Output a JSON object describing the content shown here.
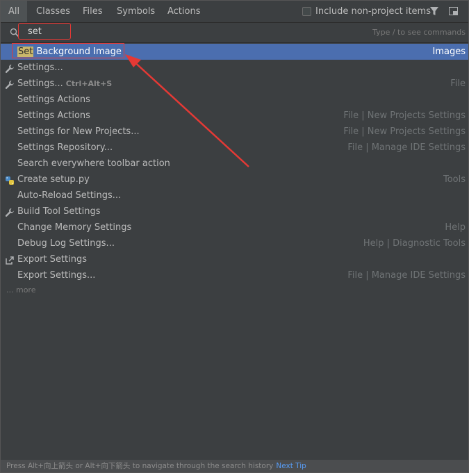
{
  "tabs": [
    "All",
    "Classes",
    "Files",
    "Symbols",
    "Actions"
  ],
  "include_label": "Include non-project items",
  "search": {
    "value": "set",
    "hint": "Type / to see commands"
  },
  "results": [
    {
      "pre": "",
      "hl": "Set",
      "post": " Background Image",
      "shortcut": "",
      "loc": "Images",
      "icon": "",
      "selected": true
    },
    {
      "pre": "Settings...",
      "hl": "",
      "post": "",
      "shortcut": "",
      "loc": "",
      "icon": "wrench-icon"
    },
    {
      "pre": "Settings...",
      "hl": "",
      "post": "",
      "shortcut": "Ctrl+Alt+S",
      "loc": "File",
      "icon": "wrench-icon"
    },
    {
      "pre": "Settings Actions",
      "hl": "",
      "post": "",
      "shortcut": "",
      "loc": "",
      "icon": ""
    },
    {
      "pre": "Settings Actions",
      "hl": "",
      "post": "",
      "shortcut": "",
      "loc": "File | New Projects Settings",
      "icon": ""
    },
    {
      "pre": "Settings for New Projects...",
      "hl": "",
      "post": "",
      "shortcut": "",
      "loc": "File | New Projects Settings",
      "icon": ""
    },
    {
      "pre": "Settings Repository...",
      "hl": "",
      "post": "",
      "shortcut": "",
      "loc": "File | Manage IDE Settings",
      "icon": ""
    },
    {
      "pre": "Search everywhere toolbar action",
      "hl": "",
      "post": "",
      "shortcut": "",
      "loc": "",
      "icon": ""
    },
    {
      "pre": "Create setup.py",
      "hl": "",
      "post": "",
      "shortcut": "",
      "loc": "Tools",
      "icon": "python-icon"
    },
    {
      "pre": "Auto-Reload Settings...",
      "hl": "",
      "post": "",
      "shortcut": "",
      "loc": "",
      "icon": ""
    },
    {
      "pre": "Build Tool Settings",
      "hl": "",
      "post": "",
      "shortcut": "",
      "loc": "",
      "icon": "wrench-icon"
    },
    {
      "pre": "Change Memory Settings",
      "hl": "",
      "post": "",
      "shortcut": "",
      "loc": "Help",
      "icon": ""
    },
    {
      "pre": "Debug Log Settings...",
      "hl": "",
      "post": "",
      "shortcut": "",
      "loc": "Help | Diagnostic Tools",
      "icon": ""
    },
    {
      "pre": "Export Settings",
      "hl": "",
      "post": "",
      "shortcut": "",
      "loc": "",
      "icon": "export-icon"
    },
    {
      "pre": "Export Settings...",
      "hl": "",
      "post": "",
      "shortcut": "",
      "loc": "File | Manage IDE Settings",
      "icon": ""
    }
  ],
  "more_label": "... more",
  "status": {
    "text": "Press Alt+向上箭头 or Alt+向下箭头 to navigate through the search history",
    "link": "Next Tip"
  },
  "colors": {
    "selection": "#4b6eaf",
    "annotation": "#e53935",
    "highlight": "#c9b76b",
    "background": "#3c3f41"
  }
}
